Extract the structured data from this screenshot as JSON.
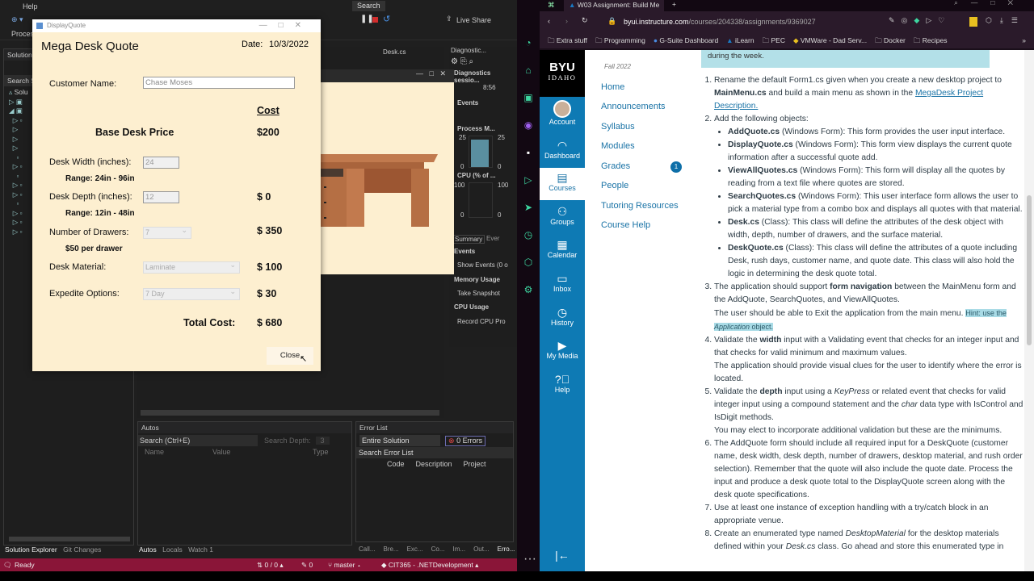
{
  "vs": {
    "menu_help": "Help",
    "process_label": "Process",
    "live_share": "Live Share",
    "search_btn": "Search",
    "solution_explorer": "Solution E",
    "search_solution": "Search So",
    "solution_node": "Solu",
    "editor_tab": "Desk.cs",
    "diagnostics": {
      "title": "Diagnostic...",
      "session": "Diagnostics sessio...",
      "time": "8:56",
      "events": "Events",
      "process_memory": "Process M...",
      "mem_max": "25",
      "mem_min": "0",
      "cpu": "CPU (% of ...",
      "cpu_max": "100",
      "cpu_min": "0",
      "tab_summary": "Summary",
      "tab_events": "Ever",
      "sec_events": "Events",
      "show_events": "Show Events (0 o",
      "sec_memory": "Memory Usage",
      "take_snapshot": "Take Snapshot",
      "sec_cpu": "CPU Usage",
      "record_cpu": "Record CPU Pro",
      "memory_fill_pct": 90
    },
    "autos": {
      "title": "Autos",
      "search": "Search (Ctrl+E)",
      "search_depth": "Search Depth:",
      "depth": "3",
      "cols": [
        "Name",
        "Value",
        "Type"
      ],
      "tabs": [
        "Autos",
        "Locals",
        "Watch 1"
      ]
    },
    "errors": {
      "title": "Error List",
      "scope": "Entire Solution",
      "count": "0 Errors",
      "search": "Search Error List",
      "cols": [
        "Code",
        "Description",
        "Project"
      ],
      "tabs": [
        "Call...",
        "Bre...",
        "Exc...",
        "Co...",
        "Im...",
        "Out...",
        "Erro..."
      ]
    },
    "left_tabs": [
      "Solution Explorer",
      "Git Changes"
    ],
    "status": {
      "ready": "Ready",
      "sync": "0 / 0",
      "edits": "0",
      "branch": "master",
      "repo": "CIT365 - .NETDevelopment"
    }
  },
  "dialog": {
    "title": "DisplayQuote",
    "heading": "Mega Desk Quote",
    "date_label": "Date:",
    "date": "10/3/2022",
    "customer_label": "Customer Name:",
    "customer": "Chase Moses",
    "cost_header": "Cost",
    "base_label": "Base Desk Price",
    "base_cost": "$200",
    "width_label": "Desk Width (inches):",
    "width": "24",
    "width_range": "Range: 24in - 96in",
    "depth_label": "Desk Depth (inches):",
    "depth": "12",
    "depth_range": "Range: 12in - 48in",
    "area_cost": "$ 0",
    "drawers_label": "Number of Drawers:",
    "drawers": "7",
    "drawer_note": "$50 per drawer",
    "drawer_cost": "$ 350",
    "material_label": "Desk Material:",
    "material": "Laminate",
    "material_cost": "$ 100",
    "expedite_label": "Expedite Options:",
    "expedite": "7 Day",
    "expedite_cost": "$ 30",
    "total_label": "Total Cost:",
    "total": "$ 680",
    "close": "Close"
  },
  "browser": {
    "tab_title": "W03 Assignment: Build Me",
    "url_host": "byui.instructure.com",
    "url_path": "/courses/204338/assignments/9369027",
    "bookmarks": [
      "Extra stuff",
      "Programming",
      "G-Suite Dashboard",
      "iLearn",
      "PEC",
      "VMWare - Dad Serv...",
      "Docker",
      "Recipes"
    ],
    "logo_top": "BYU",
    "logo_bottom": "IDAHO",
    "global_nav": [
      "Account",
      "Dashboard",
      "Courses",
      "Groups",
      "Calendar",
      "Inbox",
      "History",
      "My Media",
      "Help"
    ],
    "term": "Fall 2022",
    "course_nav": [
      "Home",
      "Announcements",
      "Syllabus",
      "Modules",
      "Grades",
      "People",
      "Tutoring Resources",
      "Course Help"
    ],
    "grades_badge": "1",
    "callout": "during the week.",
    "accent": "#0e7ab4"
  },
  "instructions": [
    {
      "segs": [
        [
          "Rename the default Form1.cs given when you create a new desktop project to "
        ],
        [
          "MainMenu.cs",
          "b"
        ],
        [
          " and build a main menu as shown in the "
        ],
        [
          "MegaDesk Project Description.",
          "a"
        ]
      ]
    },
    {
      "segs": [
        [
          "Add the following objects:"
        ]
      ],
      "sub": [
        [
          [
            "AddQuote.cs",
            "b"
          ],
          [
            " (Windows Form): This form provides the user input interface."
          ]
        ],
        [
          [
            "DisplayQuote.cs",
            "b"
          ],
          [
            " (Windows Form): This form view displays the current quote information after a successful quote add."
          ]
        ],
        [
          [
            "ViewAllQuotes.cs",
            "b"
          ],
          [
            " (Windows Form): This form will display all the quotes by reading from a text file where quotes are stored."
          ]
        ],
        [
          [
            "SearchQuotes.cs",
            "b"
          ],
          [
            " (Windows Form): This user interface form allows the user to pick a material type from a combo box and displays all quotes with that material."
          ]
        ],
        [
          [
            "Desk.cs",
            "b"
          ],
          [
            " (Class): This class will define the attributes of the desk object with width, depth, number of drawers, and the surface material."
          ]
        ],
        [
          [
            "DeskQuote.cs",
            "b"
          ],
          [
            " (Class): This class will define the attributes of a quote including Desk, rush days, customer name, and quote date. This class will also hold the logic in determining the desk quote total."
          ]
        ]
      ]
    },
    {
      "segs": [
        [
          "The application should support "
        ],
        [
          "form navigation",
          "b"
        ],
        [
          " between the MainMenu form and the AddQuote, SearchQuotes, and ViewAllQuotes."
        ],
        [
          "\n"
        ],
        [
          "The user should be able to Exit the application from the main menu. "
        ],
        [
          " Hint: use the ",
          "h"
        ],
        [
          "Application",
          "hi"
        ],
        [
          " object. ",
          "h"
        ]
      ]
    },
    {
      "segs": [
        [
          "Validate the "
        ],
        [
          "width",
          "b"
        ],
        [
          " input with a Validating event that checks for an integer input and that checks for valid minimum and maximum values."
        ],
        [
          "\n"
        ],
        [
          "The application should provide visual clues for the user to identify where the error is located."
        ]
      ]
    },
    {
      "segs": [
        [
          "Validate the "
        ],
        [
          "depth",
          "b"
        ],
        [
          " input using a "
        ],
        [
          "KeyPress",
          "i"
        ],
        [
          " or related event that checks for valid integer input using a compound statement and the "
        ],
        [
          "char",
          "i"
        ],
        [
          " data type with IsControl and IsDigit methods."
        ],
        [
          "\n"
        ],
        [
          "You may elect to incorporate additional validation but these are the minimums."
        ]
      ]
    },
    {
      "segs": [
        [
          "The AddQuote form should include all required input for a DeskQuote (customer name, desk width, desk depth, number of drawers, desktop material, and rush order selection). Remember that the quote will also include the quote date. Process the input and produce a desk quote total to the DisplayQuote screen along with the desk quote specifications."
        ]
      ]
    },
    {
      "segs": [
        [
          "Use at least one instance of exception handling with a try/catch block in an appropriate venue."
        ]
      ]
    },
    {
      "segs": [
        [
          "Create an enumerated type named "
        ],
        [
          "DesktopMaterial",
          "i"
        ],
        [
          " for the desktop materials defined within your "
        ],
        [
          "Desk.cs",
          "i"
        ],
        [
          " class. Go ahead and store this enumerated type in"
        ]
      ]
    }
  ]
}
